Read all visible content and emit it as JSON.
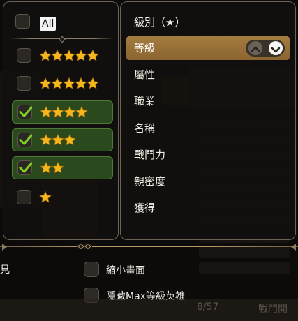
{
  "filter": {
    "all_label": "All",
    "rows": [
      {
        "stars": 5,
        "checked": false
      },
      {
        "stars": 5,
        "checked": false
      },
      {
        "stars": 4,
        "checked": true
      },
      {
        "stars": 3,
        "checked": true
      },
      {
        "stars": 2,
        "checked": true
      },
      {
        "stars": 1,
        "checked": false
      }
    ]
  },
  "sort": {
    "title": "級別（★）",
    "items": [
      "等級",
      "屬性",
      "職業",
      "名稱",
      "戰鬥力",
      "親密度",
      "獲得"
    ],
    "selected_index": 0
  },
  "options": {
    "cutoff_text": "見",
    "shrink_label": "縮小畫面",
    "hide_max_label": "隱藏Max等級英雄"
  },
  "background_text": {
    "count": "8/57",
    "battle": "戰鬥開"
  },
  "colors": {
    "star": "#f5b81c",
    "check": "#7ed321",
    "selected_bg": "#9a713a",
    "checked_row_bg": "#2a4a1d"
  }
}
